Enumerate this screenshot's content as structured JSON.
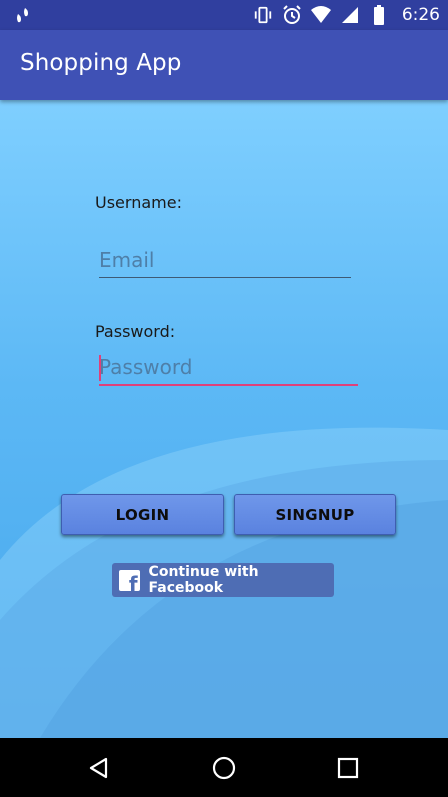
{
  "status_bar": {
    "time": "6:26",
    "left_icon": "usb-debug-icon",
    "icons": [
      "vibrate-icon",
      "alarm-icon",
      "wifi-icon",
      "cell-signal-icon",
      "battery-icon"
    ]
  },
  "app_bar": {
    "title": "Shopping App"
  },
  "form": {
    "username_label": "Username:",
    "email_placeholder": "Email",
    "email_value": "",
    "password_label": "Password:",
    "password_placeholder": "Password",
    "password_value": ""
  },
  "buttons": {
    "login": "LOGIN",
    "signup": "SINGNUP",
    "facebook": "Continue with Facebook",
    "facebook_icon": "facebook-icon"
  },
  "nav_bar": {
    "icons": [
      "back-icon",
      "home-icon",
      "recents-icon"
    ]
  },
  "colors": {
    "status_bar": "#303F9F",
    "app_bar": "#3F51B5",
    "accent": "#E0407A",
    "button": "#5A82DF",
    "facebook": "#4E6DB4"
  }
}
